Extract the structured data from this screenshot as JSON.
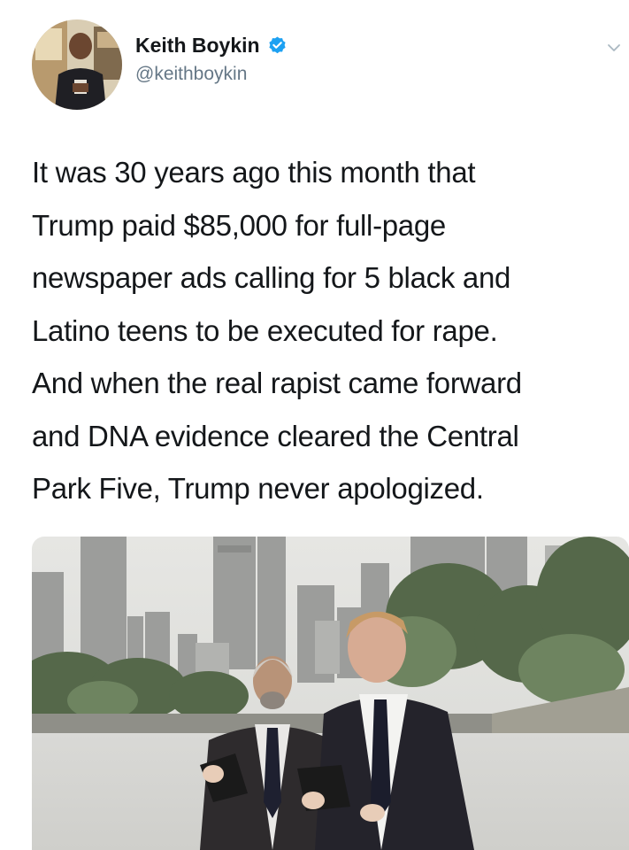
{
  "author": {
    "display_name": "Keith Boykin",
    "handle": "@keithboykin",
    "verified": true,
    "avatar_icon": "profile-photo"
  },
  "tweet": {
    "text_lines": [
      "It was 30 years ago this month that",
      "Trump paid $85,000 for full-page",
      "newspaper ads calling for 5 black and",
      "Latino teens to be executed for rape.",
      "And when the real rapist came forward",
      "and DNA evidence cleared the Central",
      "Park Five, Trump never apologized."
    ]
  },
  "media": {
    "type": "photo"
  },
  "colors": {
    "verified_badge": "#1da1f2",
    "handle_text": "#657786",
    "primary_text": "#14171a"
  },
  "icons": {
    "verified": "verified-badge-icon",
    "menu": "chevron-down-icon"
  }
}
